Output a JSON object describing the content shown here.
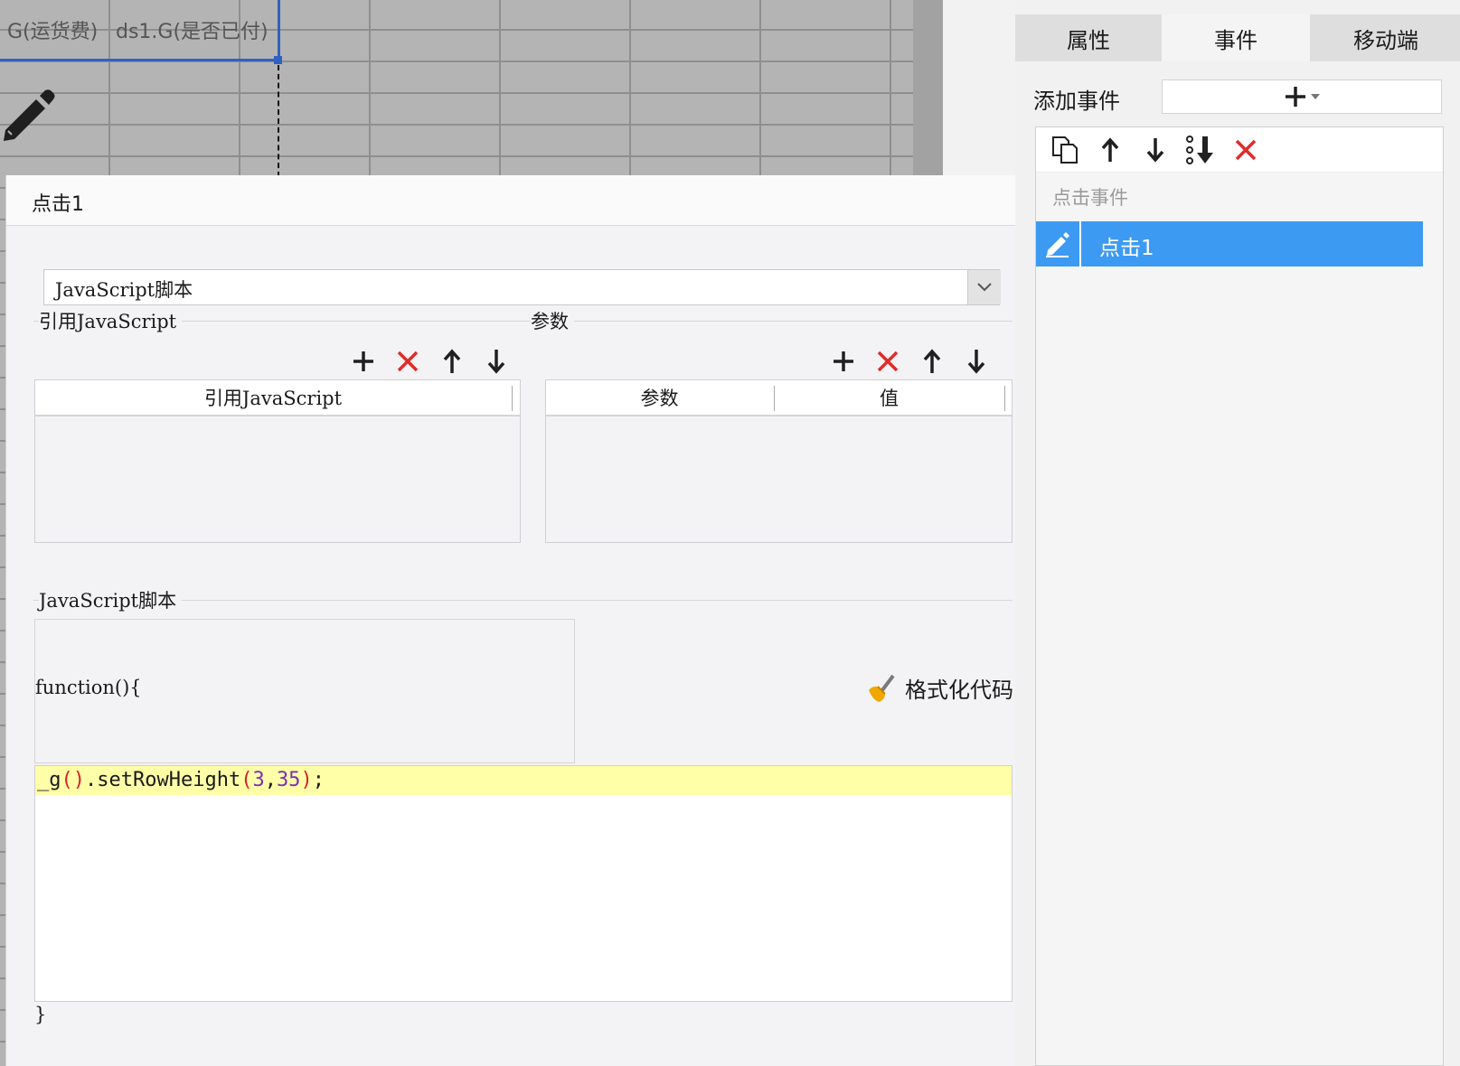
{
  "sheet": {
    "column_header_1": "G(运货费)",
    "column_header_2": "ds1.G(是否已付)"
  },
  "dialog": {
    "title": "点击1",
    "type_select": {
      "value": "JavaScript脚本"
    },
    "ref_js": {
      "group_label": "引用JavaScript",
      "column_header": "引用JavaScript",
      "rows": []
    },
    "params": {
      "group_label": "参数",
      "columns": [
        "参数",
        "值"
      ],
      "rows": []
    },
    "script": {
      "group_label": "JavaScript脚本",
      "function_open": "function(){",
      "function_close": "}",
      "code_line": "_g().setRowHeight(3,35);",
      "format_button_label": "格式化代码"
    }
  },
  "right_panel": {
    "tabs": [
      {
        "label": "属性"
      },
      {
        "label": "事件",
        "active": true
      },
      {
        "label": "移动端"
      }
    ],
    "add_event_label": "添加事件",
    "event_group_label": "点击事件",
    "events": [
      {
        "label": "点击1",
        "selected": true
      }
    ]
  },
  "colors": {
    "accent_blue": "#3d9af2",
    "delete_red": "#e02b2b",
    "highlight_line": "#ffffa8",
    "selection_border": "#2f62c0"
  },
  "icons": [
    "pencil-icon",
    "chevron-down-icon",
    "plus-icon",
    "delete-icon",
    "arrow-up-icon",
    "arrow-down-icon",
    "copy-icon",
    "sort-icon",
    "broom-icon",
    "edit-icon"
  ]
}
